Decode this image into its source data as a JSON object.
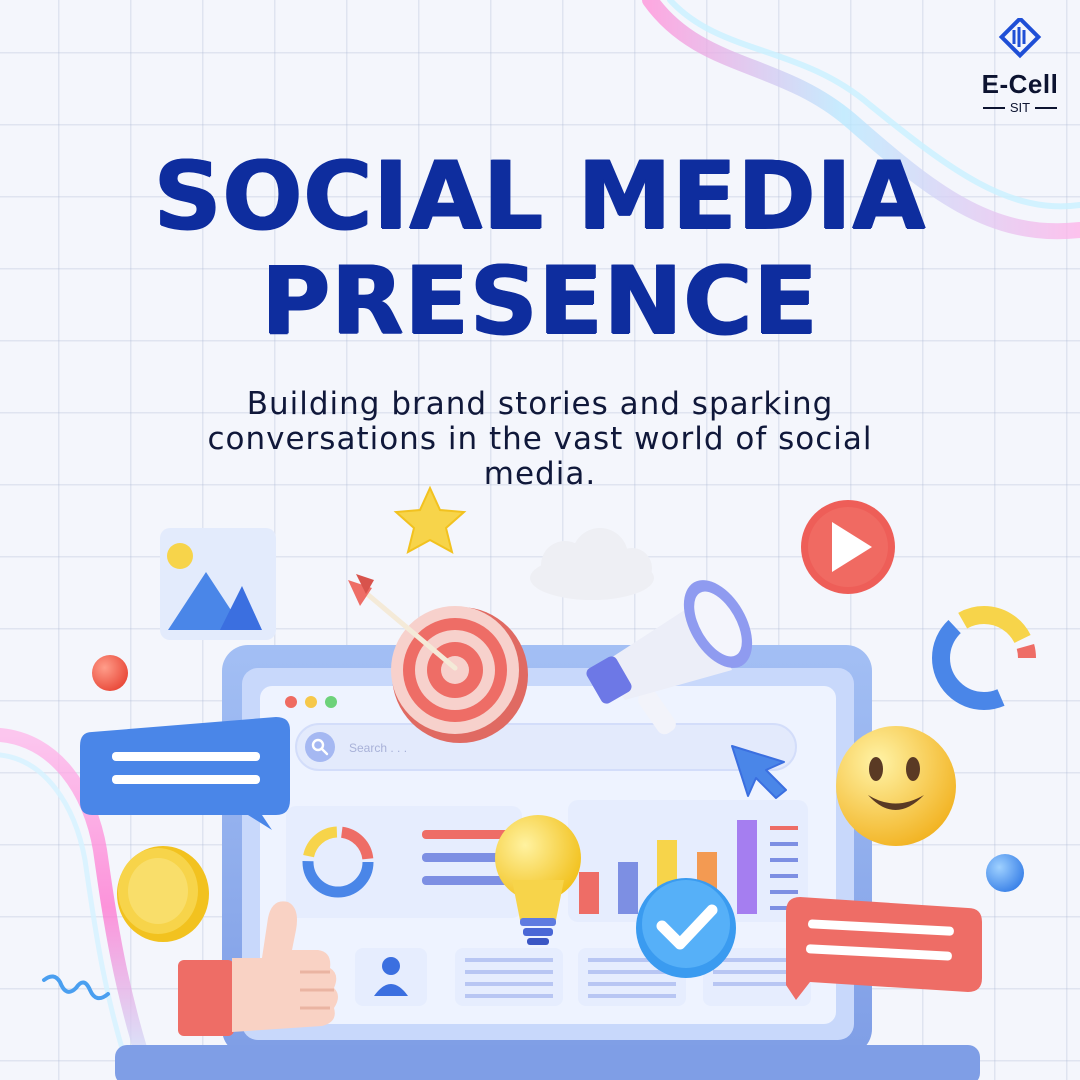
{
  "brand": {
    "logo_title": "E-Cell",
    "logo_subtitle": "SIT",
    "logo_icon": "diamond-signal-icon"
  },
  "headline": {
    "line1": "SOCIAL MEDIA",
    "line2": "PRESENCE"
  },
  "subtitle": "Building brand stories and sparking conversations in the vast world of social media.",
  "laptop": {
    "search_placeholder": "Search . . ."
  },
  "colors": {
    "headline": "#0e2d9e",
    "subtitle": "#10183a",
    "background": "#f4f6fc",
    "laptop_frame": "#8aa9ea",
    "accent_red": "#ee6d66",
    "accent_blue": "#4a86e8",
    "accent_yellow": "#f7d44a"
  },
  "icons": [
    "image-icon",
    "star-icon",
    "cloud-icon",
    "play-button-icon",
    "target-icon",
    "arrow-icon",
    "megaphone-icon",
    "donut-chart-icon",
    "red-ball-icon",
    "chat-bubble-blue-icon",
    "smiley-emoji-icon",
    "coin-icon",
    "blue-ball-icon",
    "lightbulb-icon",
    "bar-chart-icon",
    "checkmark-badge-icon",
    "chat-bubble-red-icon",
    "thumbs-up-icon",
    "cursor-icon",
    "user-icon",
    "squiggle-icon"
  ]
}
